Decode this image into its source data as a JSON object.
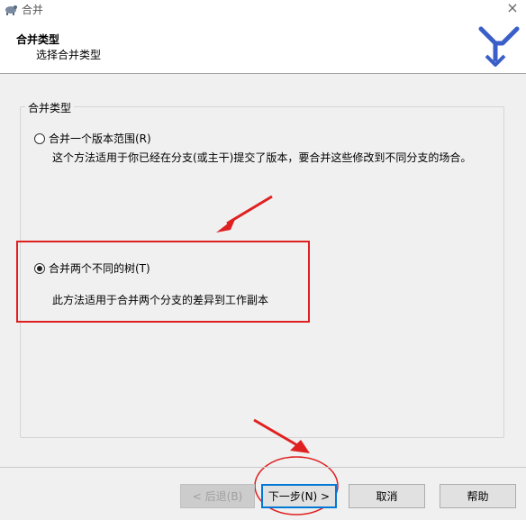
{
  "window": {
    "title": "合并",
    "close_glyph": "×"
  },
  "header": {
    "title": "合并类型",
    "subtitle": "选择合并类型"
  },
  "group": {
    "legend": "合并类型"
  },
  "options": [
    {
      "label": "合并一个版本范围(R)",
      "description": "这个方法适用于你已经在分支(或主干)提交了版本，要合并这些修改到不同分支的场合。",
      "checked": false
    },
    {
      "label": "合并两个不同的树(T)",
      "description": "此方法适用于合并两个分支的差异到工作副本",
      "checked": true
    }
  ],
  "buttons": {
    "back": "< 后退(B)",
    "next": "下一步(N) >",
    "cancel": "取消",
    "help": "帮助"
  },
  "colors": {
    "annotation_red": "#e02020",
    "logo_blue": "#3a5fc8"
  }
}
